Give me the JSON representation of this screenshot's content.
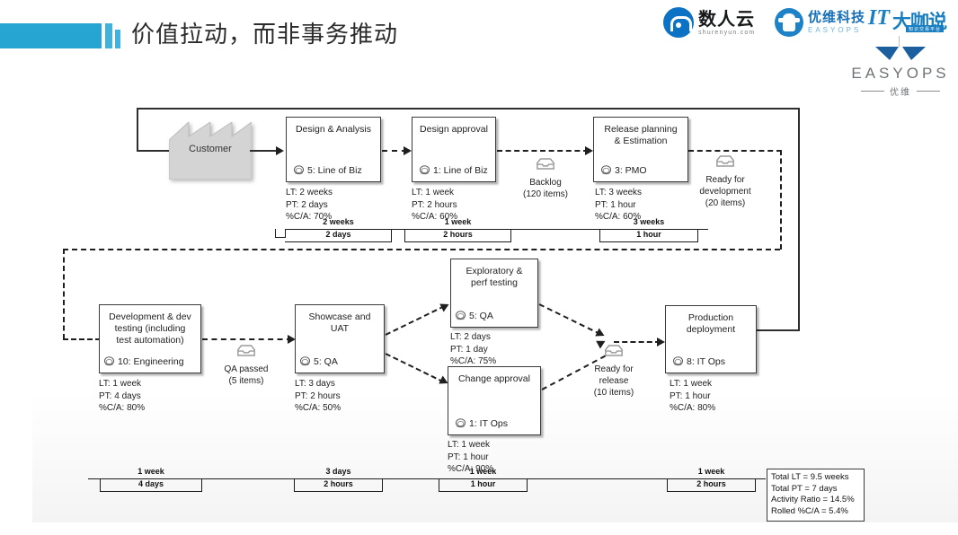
{
  "slide": {
    "title": "价值拉动，而非事务推动"
  },
  "logos": {
    "shurenyun": {
      "cn": "数人云",
      "en": "shurenyun.com"
    },
    "easyops_top": {
      "cn": "优维科技",
      "en": "EASYOPS"
    },
    "itdks": {
      "it": "IT",
      "cn": "大咖说",
      "sub": "知识交易平台"
    },
    "easyops_big": {
      "word": "EASYOPS",
      "cn": "优维"
    }
  },
  "diagram": {
    "customer": {
      "label": "Customer"
    },
    "processes": [
      {
        "id": "design-analysis",
        "title": "Design & Analysis",
        "role": "5: Line of Biz",
        "lt": "LT: 2 weeks",
        "pt": "PT: 2 days",
        "ca": "%C/A: 70%"
      },
      {
        "id": "design-approval",
        "title": "Design approval",
        "role": "1: Line of Biz",
        "lt": "LT: 1 week",
        "pt": "PT: 2 hours",
        "ca": "%C/A: 60%"
      },
      {
        "id": "release-planning",
        "title": "Release planning & Estimation",
        "title_line1": "Release planning",
        "title_line2": "& Estimation",
        "role": "3: PMO",
        "lt": "LT: 3 weeks",
        "pt": "PT: 1 hour",
        "ca": "%C/A: 60%"
      },
      {
        "id": "development",
        "title": "Development & dev testing (including test automation)",
        "title_line1": "Development & dev",
        "title_line2": "testing (including",
        "title_line3": "test automation)",
        "role": "10: Engineering",
        "lt": "LT: 1 week",
        "pt": "PT: 4 days",
        "ca": "%C/A: 80%"
      },
      {
        "id": "showcase-uat",
        "title": "Showcase and UAT",
        "title_line1": "Showcase and",
        "title_line2": "UAT",
        "role": "5: QA",
        "lt": "LT: 3 days",
        "pt": "PT: 2 hours",
        "ca": "%C/A: 50%"
      },
      {
        "id": "exploratory-testing",
        "title": "Exploratory & perf testing",
        "title_line1": "Exploratory &",
        "title_line2": "perf testing",
        "role": "5: QA",
        "lt": "LT: 2 days",
        "pt": "PT: 1 day",
        "ca": "%C/A: 75%"
      },
      {
        "id": "change-approval",
        "title": "Change approval",
        "role": "1: IT Ops",
        "lt": "LT: 1 week",
        "pt": "PT: 1 hour",
        "ca": "%C/A: 90%"
      },
      {
        "id": "production-deployment",
        "title": "Production deployment",
        "title_line1": "Production",
        "title_line2": "deployment",
        "role": "8: IT Ops",
        "lt": "LT: 1 week",
        "pt": "PT: 1 hour",
        "ca": "%C/A: 80%"
      }
    ],
    "inventories": [
      {
        "id": "backlog",
        "name": "Backlog",
        "count": "(120 items)"
      },
      {
        "id": "ready-for-development",
        "name_line1": "Ready for",
        "name_line2": "development",
        "count": "(20 items)"
      },
      {
        "id": "qa-passed",
        "name": "QA passed",
        "count": "(5 items)"
      },
      {
        "id": "ready-for-release",
        "name_line1": "Ready for",
        "name_line2": "release",
        "count": "(10 items)"
      }
    ],
    "timeline_top": [
      {
        "lt": "2 weeks",
        "pt": "2 days"
      },
      {
        "lt": "1 week",
        "pt": "2 hours"
      },
      {
        "lt": "3 weeks",
        "pt": "1 hour"
      }
    ],
    "timeline_bottom": [
      {
        "lt": "1 week",
        "pt": "4 days"
      },
      {
        "lt": "3 days",
        "pt": "2 hours"
      },
      {
        "lt": "1 week",
        "pt": "1 hour"
      },
      {
        "lt": "1 week",
        "pt": "2 hours"
      }
    ],
    "summary": {
      "total_lt": "Total LT = 9.5 weeks",
      "total_pt": "Total PT = 7 days",
      "activity_ratio": "Activity Ratio = 14.5%",
      "rolled_ca": "Rolled %C/A = 5.4%"
    }
  },
  "colors": {
    "accent": "#26a4d2",
    "line": "#2e2e2e",
    "box_border": "#3a3a3a",
    "customer_fill": "#d4d4d4"
  }
}
